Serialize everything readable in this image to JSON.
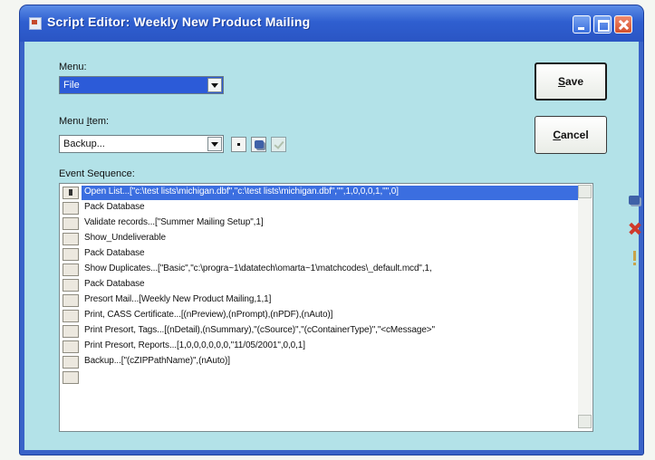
{
  "window": {
    "title": "Script Editor: Weekly New Product Mailing"
  },
  "menu": {
    "label_prefix": "Menu",
    "label_suffix": ":",
    "selected": "File"
  },
  "menu_item": {
    "label_prefix": "Menu ",
    "label_key": "I",
    "label_rest": "tem:",
    "selected": "Backup..."
  },
  "buttons": {
    "save_key": "S",
    "save_rest": "ave",
    "cancel_key": "C",
    "cancel_rest": "ancel"
  },
  "events": {
    "label": "Event Sequence:",
    "items": [
      {
        "text": "Open List...[\"c:\\test lists\\michigan.dbf\",\"c:\\test lists\\michigan.dbf\",\"\",1,0,0,0,1,\"\",0]",
        "selected": true
      },
      {
        "text": "Pack Database",
        "selected": false
      },
      {
        "text": "Validate records...[\"Summer Mailing Setup\",1]",
        "selected": false
      },
      {
        "text": "Show_Undeliverable",
        "selected": false
      },
      {
        "text": "Pack Database",
        "selected": false
      },
      {
        "text": "Show Duplicates...[\"Basic\",\"c:\\progra~1\\datatech\\omarta~1\\matchcodes\\_default.mcd\",1,",
        "selected": false
      },
      {
        "text": "Pack Database",
        "selected": false
      },
      {
        "text": "Presort Mail...[Weekly New Product Mailing,1,1]",
        "selected": false
      },
      {
        "text": "Print, CASS Certificate...[(nPreview),(nPrompt),(nPDF),(nAuto)]",
        "selected": false
      },
      {
        "text": "Print Presort, Tags...[(nDetail),(nSummary),\"(cSource)\",\"(cContainerType)\",\"<cMessage>\"",
        "selected": false
      },
      {
        "text": "Print Presort, Reports...[1,0,0,0,0,0,0,\"11/05/2001\",0,0,1]",
        "selected": false
      },
      {
        "text": "Backup...[\"(cZIPPathName)\",(nAuto)]",
        "selected": false
      }
    ]
  },
  "icons": {
    "app": "app-window-icon",
    "edit": "edit-event-icon",
    "delete": "delete-event-icon",
    "warning": "exclamation-icon",
    "add": "add-event-icon",
    "apply": "checkmark-icon"
  },
  "colors": {
    "titlebar": "#2f5fd0",
    "client_bg": "#b3e2e8",
    "selection": "#3b6ee0",
    "delete": "#d0392b"
  }
}
